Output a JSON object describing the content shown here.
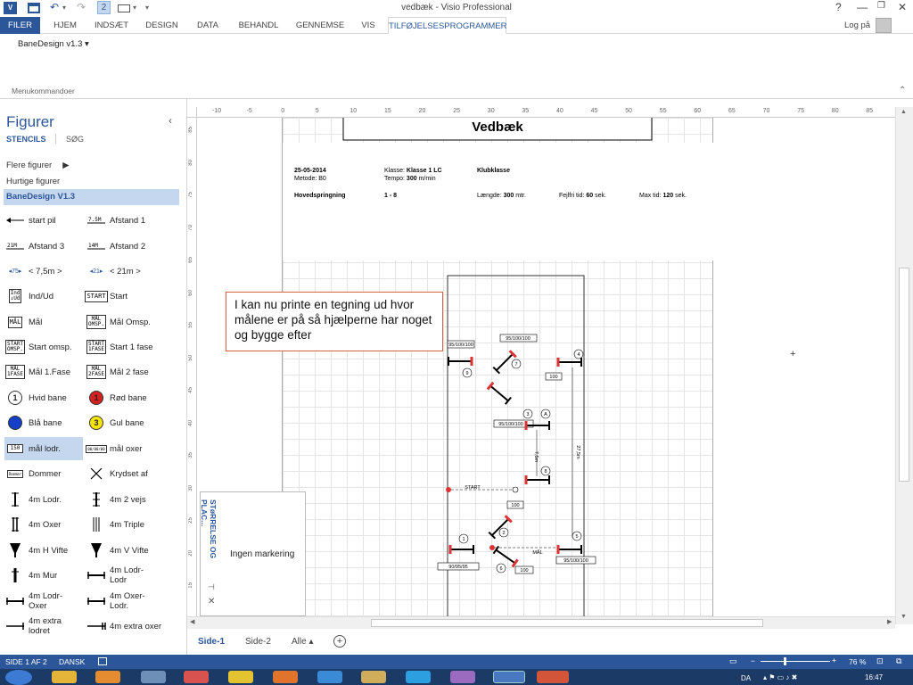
{
  "window": {
    "title": "vedbæk - Visio Professional",
    "help": "?",
    "login": "Log på"
  },
  "qat": {
    "undo": "↶",
    "redo": "↷",
    "page_num": "2"
  },
  "ribbon": {
    "tabs": [
      "FILER",
      "HJEM",
      "INDSÆT",
      "DESIGN",
      "DATA",
      "BEHANDL",
      "GENNEMSE",
      "VIS",
      "TILFØJELSESPROGRAMMER"
    ],
    "active_tab": "TILFØJELSESPROGRAMMER",
    "addin_button": "BaneDesign v1.3 ▾",
    "group_label": "Menukommandoer"
  },
  "shapes_pane": {
    "title": "Figurer",
    "tab_stencils": "STENCILS",
    "tab_search": "SØG",
    "more_shapes": "Flere figurer",
    "quick_shapes": "Hurtige figurer",
    "active_stencil": "BaneDesign V1.3",
    "items": [
      {
        "icon": "start-pil-icon",
        "label": "start pil"
      },
      {
        "icon": "afstand-1-icon",
        "label": "Afstand 1"
      },
      {
        "icon": "afstand-3-icon",
        "label": "Afstand 3"
      },
      {
        "icon": "afstand-2-icon",
        "label": "Afstand 2"
      },
      {
        "icon": "7-5m-icon",
        "label": "< 7,5m >"
      },
      {
        "icon": "21m-icon",
        "label": "< 21m >"
      },
      {
        "icon": "ind-ud-icon",
        "label": "Ind/Ud"
      },
      {
        "icon": "start-icon",
        "label": "Start"
      },
      {
        "icon": "maal-icon",
        "label": "Mål"
      },
      {
        "icon": "maal-omsp-icon",
        "label": "Mål Omsp."
      },
      {
        "icon": "start-omsp-icon",
        "label": "Start omsp."
      },
      {
        "icon": "start-1-fase-icon",
        "label": "Start 1 fase"
      },
      {
        "icon": "maal-1-fase-icon",
        "label": "Mål 1.Fase"
      },
      {
        "icon": "maal-2-fase-icon",
        "label": "Mål 2 fase"
      },
      {
        "icon": "hvid-bane-icon",
        "label": "Hvid bane"
      },
      {
        "icon": "roed-bane-icon",
        "label": "Rød bane"
      },
      {
        "icon": "blaa-bane-icon",
        "label": "Blå bane"
      },
      {
        "icon": "gul-bane-icon",
        "label": "Gul bane"
      },
      {
        "icon": "maal-lodr-icon",
        "label": "mål lodr."
      },
      {
        "icon": "maal-oxer-icon",
        "label": "mål oxer"
      },
      {
        "icon": "dommer-icon",
        "label": "Dommer"
      },
      {
        "icon": "krydset-af-icon",
        "label": "Krydset af"
      },
      {
        "icon": "4m-lodr-icon",
        "label": "4m Lodr."
      },
      {
        "icon": "4m-2-vejs-icon",
        "label": "4m 2 vejs"
      },
      {
        "icon": "4m-oxer-icon",
        "label": "4m Oxer"
      },
      {
        "icon": "4m-triple-icon",
        "label": "4m Triple"
      },
      {
        "icon": "4m-h-vifte-icon",
        "label": "4m H Vifte"
      },
      {
        "icon": "4m-v-vifte-icon",
        "label": "4m V Vifte"
      },
      {
        "icon": "4m-mur-icon",
        "label": "4m Mur"
      },
      {
        "icon": "4m-lodr-lodr-icon",
        "label": "4m Lodr-Lodr"
      },
      {
        "icon": "4m-lodr-oxer-icon",
        "label": "4m Lodr-Oxer"
      },
      {
        "icon": "4m-oxer-lodr-icon",
        "label": "4m Oxer-Lodr."
      },
      {
        "icon": "4m-extra-lodret-icon",
        "label": "4m extra lodret"
      },
      {
        "icon": "4m-extra-oxer-icon",
        "label": "4m extra oxer"
      }
    ]
  },
  "ruler": {
    "h": [
      "-10",
      "-5",
      "0",
      "5",
      "10",
      "15",
      "20",
      "25",
      "30",
      "35",
      "40",
      "45",
      "50",
      "55",
      "60",
      "65",
      "70",
      "75",
      "80",
      "85"
    ],
    "v": [
      "85",
      "80",
      "75",
      "70",
      "65",
      "60",
      "55",
      "50",
      "45",
      "40",
      "35",
      "30",
      "25",
      "20",
      "15"
    ]
  },
  "drawing": {
    "title": "Vedbæk",
    "date": "25-05-2014",
    "method_label": "Metode:",
    "method": "B0",
    "class_label": "Klasse:",
    "class": "Klasse 1  LC",
    "tempo_label": "Tempo:",
    "tempo": "300",
    "tempo_unit": "m/min",
    "club_class": "Klubklasse",
    "event": "Hovedspringning",
    "range": "1 - 8",
    "length_label": "Længde:",
    "length": "300",
    "length_unit": "mtr.",
    "fault_label": "Fejlfri tid:",
    "fault": "60",
    "fault_unit": "sek.",
    "max_label": "Max tid:",
    "max": "120",
    "max_unit": "sek.",
    "labels": {
      "h1": "95/100/100",
      "h2": "95/100/100",
      "h3": "95/100/100",
      "h4": "95/100/100",
      "h5": "90/95/95",
      "v100a": "100",
      "v100b": "100",
      "v100c": "100",
      "start": "START",
      "maal": "MÅL",
      "dist1": "7,5m",
      "dist2": "27,5m",
      "n1": "1",
      "n2": "2",
      "n3": "3",
      "n4": "4",
      "n5": "5",
      "n6": "6",
      "n7": "7",
      "n8": "8",
      "n9": "9",
      "nA": "A"
    }
  },
  "note": "I kan nu printe en tegning ud hvor målene er på så hjælperne har noget og bygge efter",
  "size_panel": {
    "title": "STøRRELSE OG PLAC...",
    "content": "Ingen markering"
  },
  "sheets": {
    "tabs": [
      "Side-1",
      "Side-2",
      "Alle ▴"
    ],
    "active": "Side-1"
  },
  "status": {
    "page": "SIDE 1 AF 2",
    "lang": "DANSK",
    "zoom": "76 %"
  },
  "taskbar": {
    "lang": "DA",
    "time": "16:47"
  }
}
